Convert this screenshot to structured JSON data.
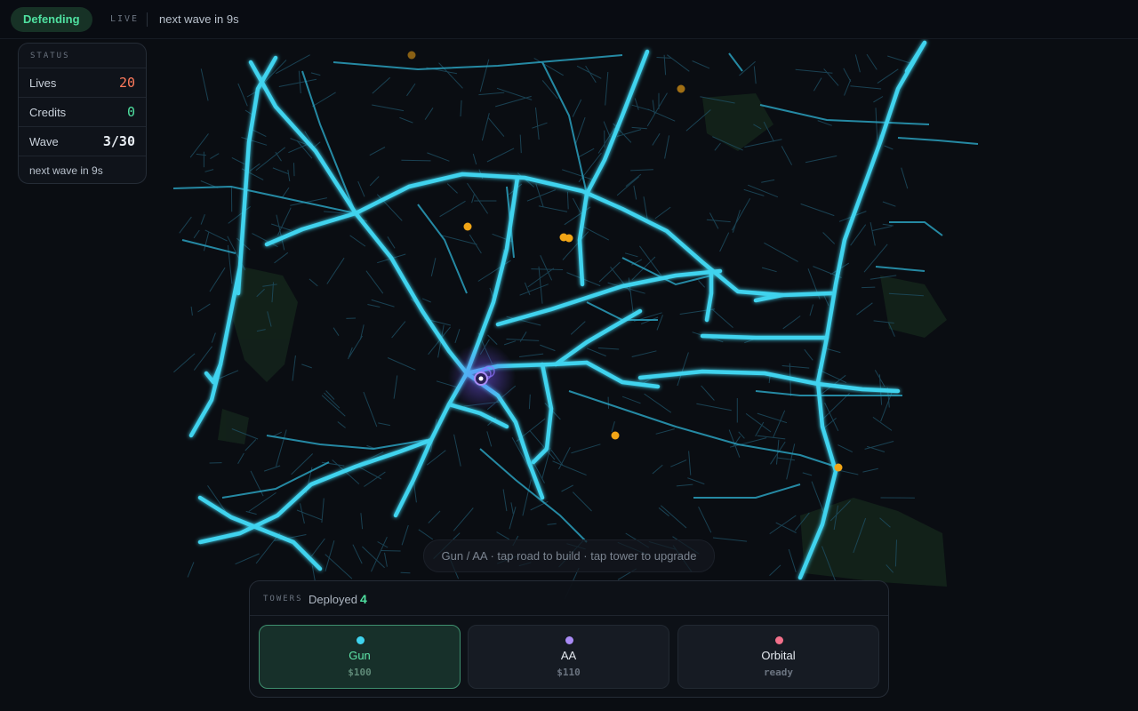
{
  "topbar": {
    "state": "Defending",
    "live": "LIVE",
    "next_wave": "next wave in 9s"
  },
  "status": {
    "title": "STATUS",
    "rows": [
      {
        "label": "Lives",
        "value": "20",
        "color": "#ff7a5c"
      },
      {
        "label": "Credits",
        "value": "0",
        "color": "#4fe0a0"
      },
      {
        "label": "Wave",
        "value": "3/30",
        "color": "#e8edf3"
      }
    ],
    "footer": "next wave in 9s"
  },
  "hint": "Gun / AA · tap road to build · tap tower to upgrade",
  "towers": {
    "label": "TOWERS",
    "deployed_label": "Deployed",
    "deployed_count": "4",
    "items": [
      {
        "name": "Gun",
        "cost": "$100",
        "color": "#3fd3ee",
        "selected": true
      },
      {
        "name": "AA",
        "cost": "$110",
        "color": "#a98bf5",
        "selected": false
      },
      {
        "name": "Orbital",
        "cost": "ready",
        "color": "#f2708a",
        "selected": false
      }
    ]
  },
  "colors": {
    "road": "#3fd3ee",
    "enemy": "#f2a516",
    "base": "#a98bf5",
    "background": "#0a0d12"
  }
}
